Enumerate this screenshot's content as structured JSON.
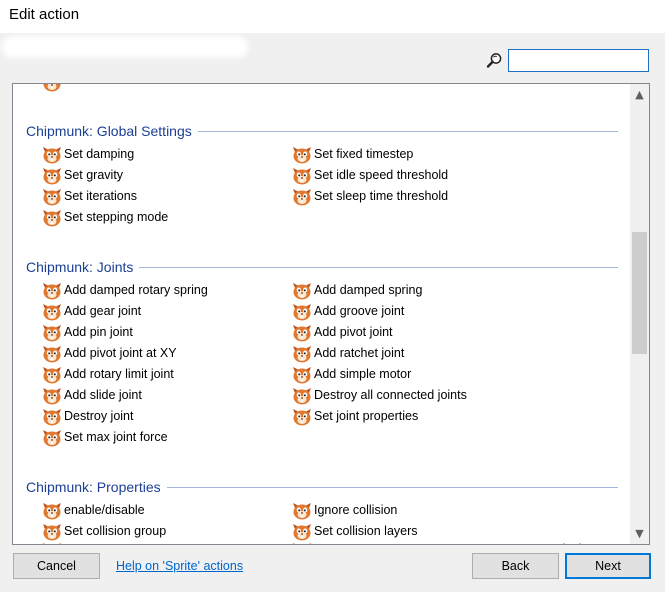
{
  "window": {
    "title": "Edit action"
  },
  "search": {
    "value": ""
  },
  "sections": [
    {
      "header": "Chipmunk: Global Settings",
      "items": [
        "Set damping",
        "Set fixed timestep",
        "Set gravity",
        "Set idle speed threshold",
        "Set iterations",
        "Set sleep time threshold",
        "Set stepping mode"
      ]
    },
    {
      "header": "Chipmunk: Joints",
      "items": [
        "Add damped rotary spring",
        "Add damped spring",
        "Add gear joint",
        "Add groove joint",
        "Add pin joint",
        "Add pivot joint",
        "Add pivot joint at XY",
        "Add ratchet joint",
        "Add rotary limit joint",
        "Add simple motor",
        "Add slide joint",
        "Destroy all connected joints",
        "Destroy joint",
        "Set joint properties",
        "Set max joint force"
      ]
    },
    {
      "header": "Chipmunk: Properties",
      "items": [
        "enable/disable",
        "Ignore collision",
        "Set collision group",
        "Set collision layers"
      ]
    }
  ],
  "buttons": {
    "cancel": "Cancel",
    "help": "Help on 'Sprite' actions",
    "back": "Back",
    "next": "Next"
  },
  "icons": {
    "search": "search-magnifier-icon",
    "action": "chipmunk-icon",
    "scroll_up": "▲",
    "scroll_down": "▼"
  },
  "colors": {
    "section_header": "#1c3f94",
    "accent": "#0078d7",
    "link": "#0066cc"
  }
}
